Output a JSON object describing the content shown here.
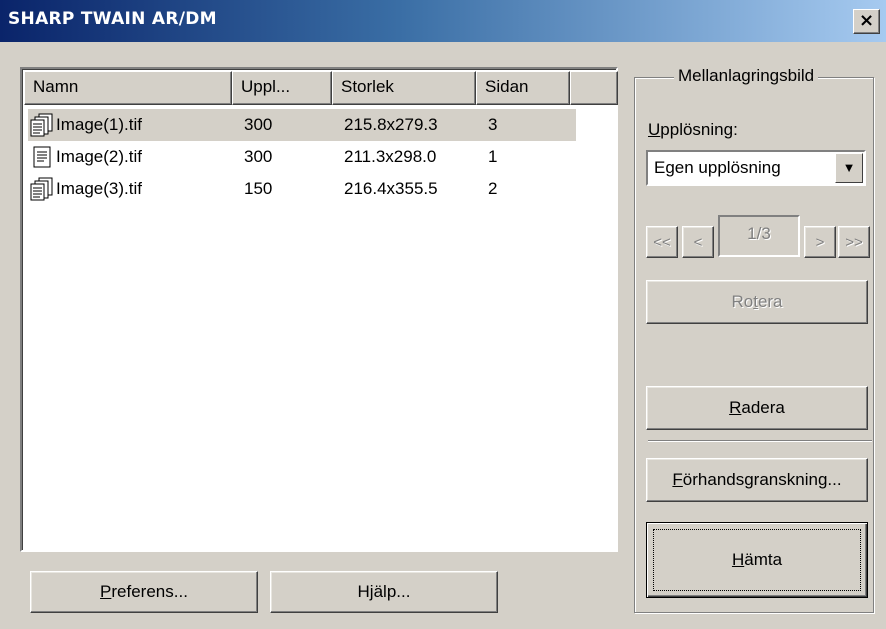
{
  "window": {
    "title": "SHARP TWAIN AR/DM",
    "close_glyph": "×"
  },
  "list": {
    "columns": [
      "Namn",
      "Uppl...",
      "Storlek",
      "Sidan"
    ],
    "rows": [
      {
        "name": "Image(1).tif",
        "res": "300",
        "size": "215.8x279.3",
        "pages": "3",
        "icon": "multi-page-doc-icon"
      },
      {
        "name": "Image(2).tif",
        "res": "300",
        "size": "211.3x298.0",
        "pages": "1",
        "icon": "single-page-doc-icon"
      },
      {
        "name": "Image(3).tif",
        "res": "150",
        "size": "216.4x355.5",
        "pages": "2",
        "icon": "multi-page-doc-icon"
      }
    ],
    "selected_row": 0
  },
  "buttons": {
    "preferens_u": "P",
    "preferens_rest": "referens...",
    "hjalp": "Hjälp..."
  },
  "panel": {
    "group_title": "Mellanlagringsbild",
    "resolution_label_u": "U",
    "resolution_label_rest": "pplösning:",
    "resolution_value": "Egen upplösning",
    "nav_first": "<<",
    "nav_prev": "<",
    "page_indicator": "1/3",
    "nav_next": ">",
    "nav_last": ">>",
    "rotate_pre": "Ro",
    "rotate_u": "t",
    "rotate_post": "era",
    "delete_u": "R",
    "delete_rest": "adera",
    "preview_u": "F",
    "preview_rest": "örhandsgranskning...",
    "fetch_u": "H",
    "fetch_rest": "ämta"
  },
  "colors": {
    "titlebar_start": "#0a246a",
    "titlebar_end": "#a6caf0",
    "face": "#d4d0c8"
  }
}
